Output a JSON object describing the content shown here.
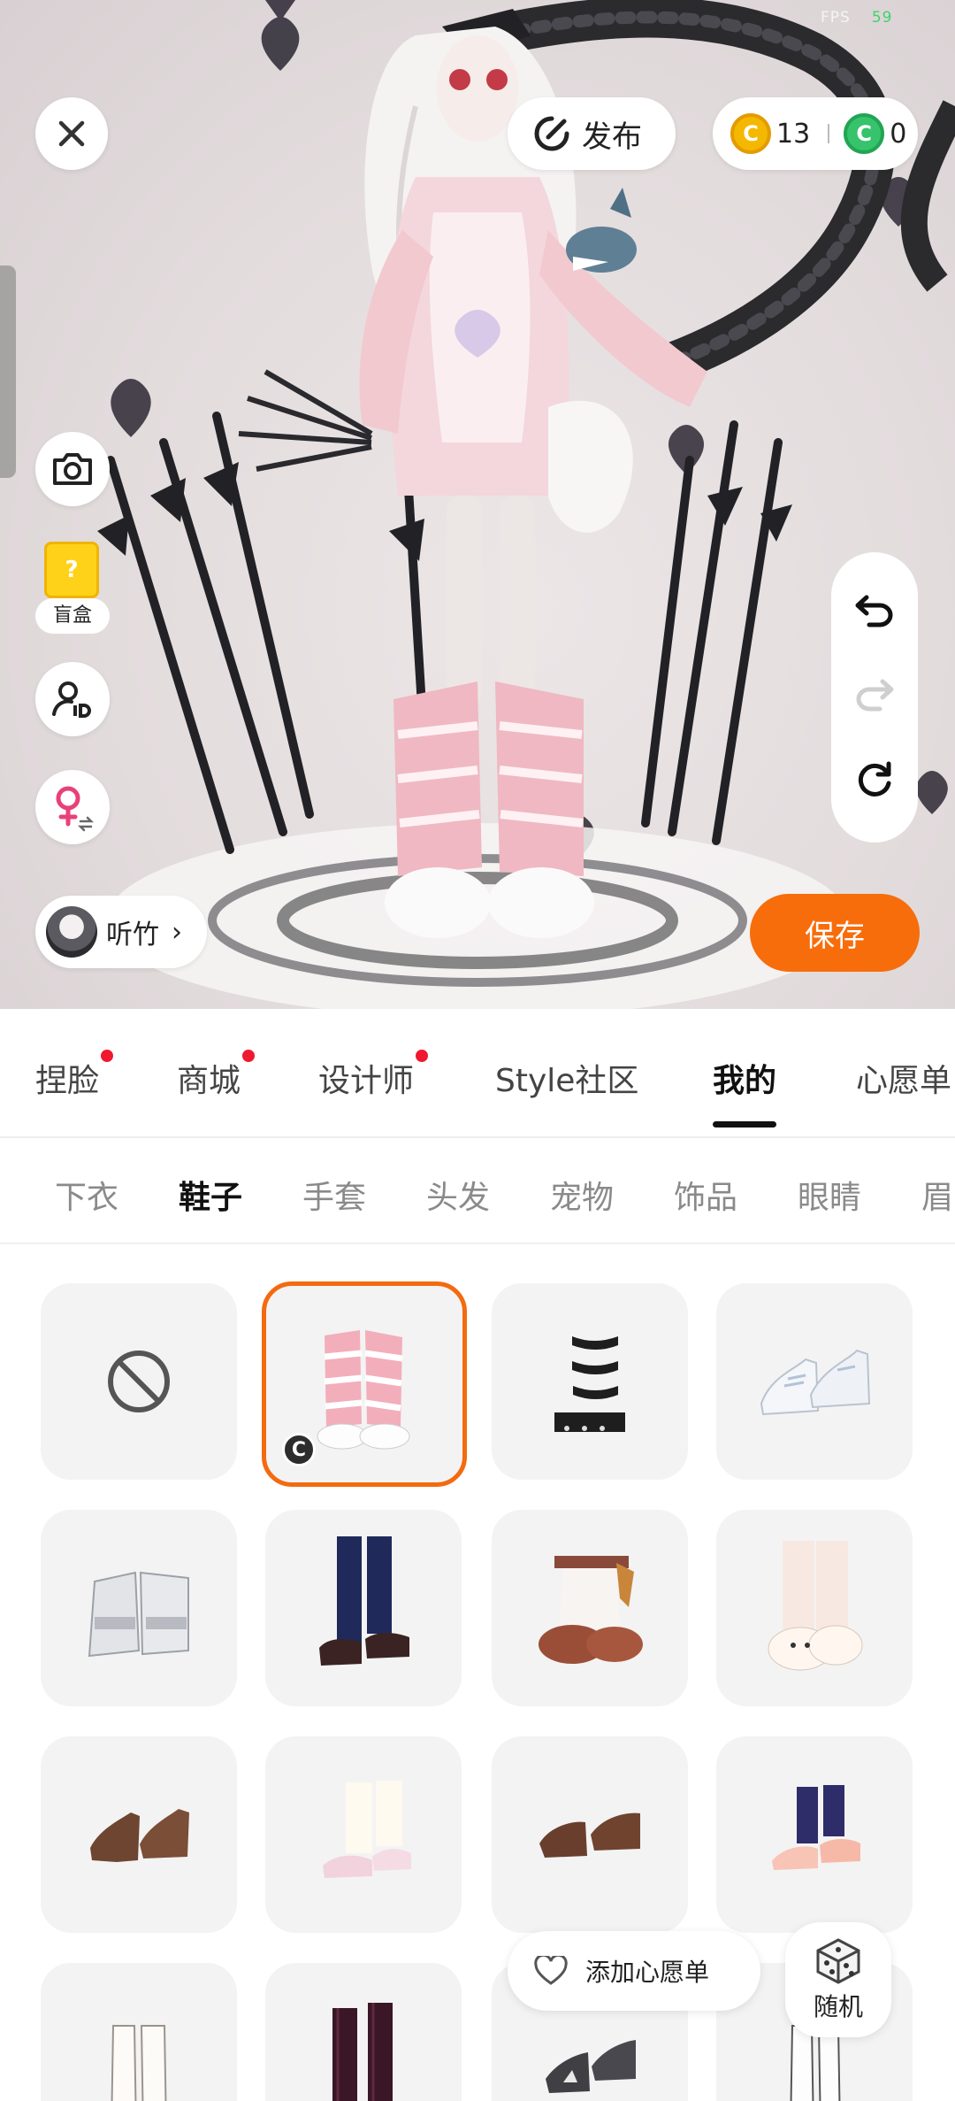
{
  "status": {
    "fps_label": "FPS",
    "fps_value": "59"
  },
  "top_bar": {
    "publish_label": "发布",
    "currency": [
      {
        "icon": "gold-coin-icon",
        "letter": "C",
        "value": "13"
      },
      {
        "icon": "green-coin-icon",
        "letter": "C",
        "value": "0"
      }
    ]
  },
  "left_tools": {
    "blindbox_label": "盲盒",
    "blindbox_mark": "?"
  },
  "user": {
    "name": "听竹",
    "chevron": "›"
  },
  "save_label": "保存",
  "main_tabs": [
    {
      "label": "捏脸",
      "dot": true
    },
    {
      "label": "商城",
      "dot": true
    },
    {
      "label": "设计师",
      "dot": true
    },
    {
      "label": "Style社区",
      "dot": false
    },
    {
      "label": "我的",
      "dot": false,
      "active": true
    },
    {
      "label": "心愿单",
      "dot": false
    }
  ],
  "sub_tabs": [
    {
      "label": "下衣"
    },
    {
      "label": "鞋子",
      "active": true
    },
    {
      "label": "手套"
    },
    {
      "label": "头发"
    },
    {
      "label": "宠物"
    },
    {
      "label": "饰品"
    },
    {
      "label": "眼睛"
    },
    {
      "label": "眉"
    }
  ],
  "items": [
    {
      "type": "none-icon"
    },
    {
      "type": "pink-striped-boots",
      "selected": true,
      "badge": "C"
    },
    {
      "type": "zebra-boots"
    },
    {
      "type": "white-sneakers"
    },
    {
      "type": "grey-boots"
    },
    {
      "type": "navy-knee-socks-loafers"
    },
    {
      "type": "fur-boots"
    },
    {
      "type": "bunny-slippers"
    },
    {
      "type": "brown-heels"
    },
    {
      "type": "white-socks-pink-shoes"
    },
    {
      "type": "brown-pumps"
    },
    {
      "type": "navy-socks-sandals"
    },
    {
      "type": "white-tall-boots"
    },
    {
      "type": "burgundy-tall-socks"
    },
    {
      "type": "black-heels"
    },
    {
      "type": "white-sock-boots"
    }
  ],
  "wishlist_label": "添加心愿单",
  "random_label": "随机",
  "colors": {
    "accent": "#f76d0c",
    "selected_border": "#f36a10",
    "dot": "#f0182f"
  }
}
